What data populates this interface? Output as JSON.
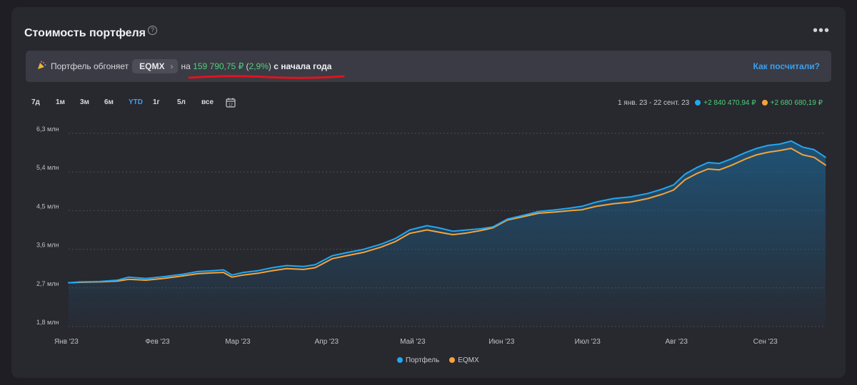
{
  "header": {
    "title": "Стоимость портфеля",
    "help_icon": "?",
    "more_icon": "•••"
  },
  "banner": {
    "prefix": "Портфель обгоняет",
    "chip": "EQMX",
    "middle": "на",
    "amount": "159 790,75 ₽",
    "paren_open": "(",
    "percent": "2,9%",
    "paren_close": ")",
    "suffix": "с начала года",
    "link": "Как посчитали?"
  },
  "periods": [
    "7д",
    "1м",
    "3м",
    "6м",
    "YTD",
    "1г",
    "5л",
    "все"
  ],
  "active_period": "YTD",
  "summary": {
    "date_range": "1 янв. 23 - 22 сент. 23",
    "portfolio_change": "+2 840 470,94 ₽",
    "index_change": "+2 680 680,19 ₽"
  },
  "colors": {
    "portfolio": "#22a7f0",
    "index": "#f5a33a",
    "accent": "#3aa0f0",
    "positive": "#4cd07a",
    "underline": "#e0141e"
  },
  "chart_data": {
    "type": "line",
    "x_ticks": [
      "Янв '23",
      "Фев '23",
      "Мар '23",
      "Апр '23",
      "Май '23",
      "Июн '23",
      "Июл '23",
      "Авг '23",
      "Сен '23"
    ],
    "y_ticks": [
      "1,8 млн",
      "2,7 млн",
      "3,6 млн",
      "4,5 млн",
      "5,4 млн",
      "6,3 млн"
    ],
    "ylim": [
      1.8,
      6.3
    ],
    "x_range": [
      "2023-01-01",
      "2023-09-22"
    ],
    "series": [
      {
        "name": "Портфель",
        "points": [
          [
            "2023-01-01",
            2.82
          ],
          [
            "2023-01-05",
            2.84
          ],
          [
            "2023-01-12",
            2.85
          ],
          [
            "2023-01-18",
            2.88
          ],
          [
            "2023-01-22",
            2.95
          ],
          [
            "2023-01-28",
            2.92
          ],
          [
            "2023-02-03",
            2.96
          ],
          [
            "2023-02-10",
            3.02
          ],
          [
            "2023-02-15",
            3.08
          ],
          [
            "2023-02-20",
            3.1
          ],
          [
            "2023-02-24",
            3.12
          ],
          [
            "2023-02-27",
            3.0
          ],
          [
            "2023-03-03",
            3.06
          ],
          [
            "2023-03-08",
            3.1
          ],
          [
            "2023-03-13",
            3.17
          ],
          [
            "2023-03-18",
            3.22
          ],
          [
            "2023-03-24",
            3.2
          ],
          [
            "2023-03-28",
            3.24
          ],
          [
            "2023-04-03",
            3.45
          ],
          [
            "2023-04-08",
            3.52
          ],
          [
            "2023-04-14",
            3.6
          ],
          [
            "2023-04-20",
            3.72
          ],
          [
            "2023-04-25",
            3.85
          ],
          [
            "2023-04-30",
            4.05
          ],
          [
            "2023-05-06",
            4.15
          ],
          [
            "2023-05-10",
            4.1
          ],
          [
            "2023-05-15",
            4.02
          ],
          [
            "2023-05-20",
            4.05
          ],
          [
            "2023-05-25",
            4.08
          ],
          [
            "2023-05-29",
            4.12
          ],
          [
            "2023-06-03",
            4.3
          ],
          [
            "2023-06-08",
            4.38
          ],
          [
            "2023-06-14",
            4.48
          ],
          [
            "2023-06-20",
            4.52
          ],
          [
            "2023-06-25",
            4.56
          ],
          [
            "2023-06-29",
            4.6
          ],
          [
            "2023-07-04",
            4.7
          ],
          [
            "2023-07-10",
            4.78
          ],
          [
            "2023-07-16",
            4.82
          ],
          [
            "2023-07-22",
            4.9
          ],
          [
            "2023-07-27",
            5.0
          ],
          [
            "2023-07-31",
            5.1
          ],
          [
            "2023-08-04",
            5.35
          ],
          [
            "2023-08-08",
            5.5
          ],
          [
            "2023-08-12",
            5.62
          ],
          [
            "2023-08-16",
            5.6
          ],
          [
            "2023-08-20",
            5.7
          ],
          [
            "2023-08-25",
            5.85
          ],
          [
            "2023-08-29",
            5.95
          ],
          [
            "2023-09-02",
            6.02
          ],
          [
            "2023-09-06",
            6.05
          ],
          [
            "2023-09-10",
            6.12
          ],
          [
            "2023-09-14",
            5.98
          ],
          [
            "2023-09-18",
            5.92
          ],
          [
            "2023-09-22",
            5.74
          ]
        ]
      },
      {
        "name": "EQMX",
        "points": [
          [
            "2023-01-01",
            2.82
          ],
          [
            "2023-01-05",
            2.83
          ],
          [
            "2023-01-12",
            2.84
          ],
          [
            "2023-01-18",
            2.86
          ],
          [
            "2023-01-22",
            2.9
          ],
          [
            "2023-01-28",
            2.88
          ],
          [
            "2023-02-03",
            2.92
          ],
          [
            "2023-02-10",
            2.98
          ],
          [
            "2023-02-15",
            3.03
          ],
          [
            "2023-02-20",
            3.05
          ],
          [
            "2023-02-24",
            3.06
          ],
          [
            "2023-02-27",
            2.95
          ],
          [
            "2023-03-03",
            3.0
          ],
          [
            "2023-03-08",
            3.04
          ],
          [
            "2023-03-13",
            3.1
          ],
          [
            "2023-03-18",
            3.15
          ],
          [
            "2023-03-24",
            3.13
          ],
          [
            "2023-03-28",
            3.17
          ],
          [
            "2023-04-03",
            3.38
          ],
          [
            "2023-04-08",
            3.45
          ],
          [
            "2023-04-14",
            3.53
          ],
          [
            "2023-04-20",
            3.65
          ],
          [
            "2023-04-25",
            3.78
          ],
          [
            "2023-04-30",
            3.97
          ],
          [
            "2023-05-06",
            4.05
          ],
          [
            "2023-05-10",
            4.0
          ],
          [
            "2023-05-15",
            3.94
          ],
          [
            "2023-05-20",
            3.98
          ],
          [
            "2023-05-25",
            4.04
          ],
          [
            "2023-05-29",
            4.1
          ],
          [
            "2023-06-03",
            4.28
          ],
          [
            "2023-06-08",
            4.35
          ],
          [
            "2023-06-14",
            4.44
          ],
          [
            "2023-06-20",
            4.47
          ],
          [
            "2023-06-25",
            4.5
          ],
          [
            "2023-06-29",
            4.52
          ],
          [
            "2023-07-04",
            4.6
          ],
          [
            "2023-07-10",
            4.66
          ],
          [
            "2023-07-16",
            4.7
          ],
          [
            "2023-07-22",
            4.78
          ],
          [
            "2023-07-27",
            4.88
          ],
          [
            "2023-07-31",
            4.98
          ],
          [
            "2023-08-04",
            5.22
          ],
          [
            "2023-08-08",
            5.36
          ],
          [
            "2023-08-12",
            5.47
          ],
          [
            "2023-08-16",
            5.45
          ],
          [
            "2023-08-20",
            5.55
          ],
          [
            "2023-08-25",
            5.7
          ],
          [
            "2023-08-29",
            5.8
          ],
          [
            "2023-09-02",
            5.86
          ],
          [
            "2023-09-06",
            5.9
          ],
          [
            "2023-09-10",
            5.95
          ],
          [
            "2023-09-14",
            5.8
          ],
          [
            "2023-09-18",
            5.74
          ],
          [
            "2023-09-22",
            5.56
          ]
        ]
      }
    ],
    "grid": true,
    "legend": "bottom"
  }
}
